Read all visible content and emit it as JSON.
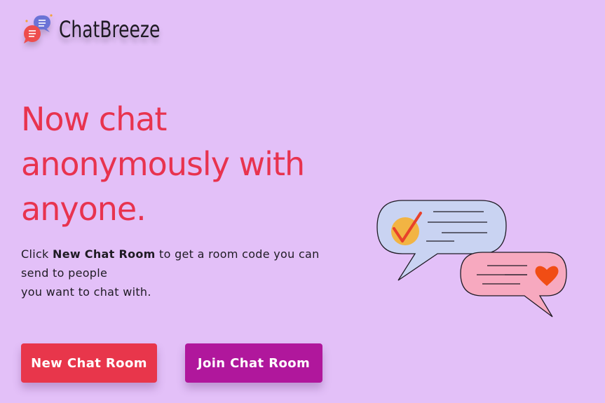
{
  "brand": {
    "name": "ChatBreeze",
    "logo_icon": "chat-bubbles-icon"
  },
  "hero": {
    "headline": "Now chat anonymously with anyone.",
    "desc_prefix": "Click ",
    "desc_bold": "New Chat Room",
    "desc_line1_rest": " to get a room code you can send to people",
    "desc_line2": "you want to chat with."
  },
  "actions": {
    "new_room_label": "New Chat Room",
    "join_room_label": "Join Chat Room"
  },
  "illustration": {
    "icons": [
      "checkmark-icon",
      "heart-icon"
    ]
  },
  "colors": {
    "background": "#e3c0f8",
    "headline": "#e8334f",
    "new_room_button": "#e8364b",
    "join_room_button": "#b0179c",
    "bubble_blue": "#c9d3f2",
    "bubble_pink": "#f7a9bf"
  }
}
